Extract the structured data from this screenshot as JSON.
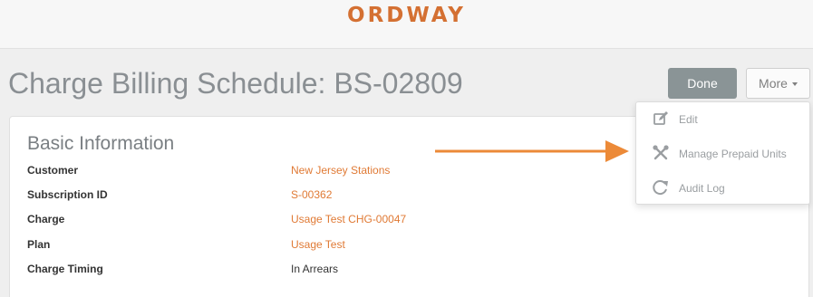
{
  "header": {
    "logo_text": "ORDWAY",
    "brand_color": "#d47032"
  },
  "page": {
    "title": "Charge Billing Schedule: BS-02809"
  },
  "actions": {
    "done_label": "Done",
    "more_label": "More"
  },
  "more_menu": {
    "items": [
      {
        "label": "Edit",
        "icon": "edit-icon"
      },
      {
        "label": "Manage Prepaid Units",
        "icon": "tools-icon"
      },
      {
        "label": "Audit Log",
        "icon": "refresh-icon"
      }
    ]
  },
  "basic_info": {
    "title": "Basic Information",
    "fields": [
      {
        "label": "Customer",
        "value": "New Jersey Stations"
      },
      {
        "label": "Subscription ID",
        "value": "S-00362"
      },
      {
        "label": "Charge",
        "value": "Usage Test CHG-00047"
      },
      {
        "label": "Plan",
        "value": "Usage Test"
      },
      {
        "label": "Charge Timing",
        "value": "In Arrears"
      }
    ]
  },
  "annotation": {
    "arrow_color": "#ec8a38"
  }
}
